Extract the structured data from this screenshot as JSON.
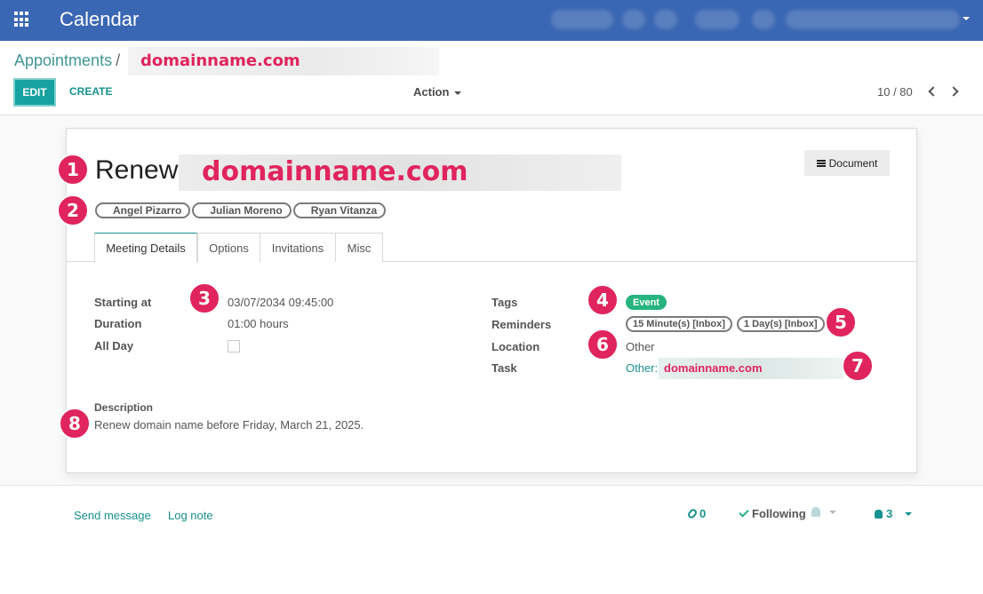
{
  "app": {
    "title": "Calendar",
    "icon": "apps-grid-icon"
  },
  "breadcrumb": {
    "parent": "Appointments",
    "separator": "/",
    "current": "domainname.com"
  },
  "toolbar": {
    "edit_label": "EDIT",
    "create_label": "CREATE",
    "action_label": "Action"
  },
  "pager": {
    "text": "10 / 80"
  },
  "record": {
    "title_prefix": "Renew",
    "title_domain": "domainname.com",
    "document_button": "Document",
    "attendees": [
      "Angel Pizarro",
      "Julian Moreno",
      "Ryan Vitanza"
    ]
  },
  "tabs": [
    {
      "label": "Meeting Details",
      "active": true
    },
    {
      "label": "Options",
      "active": false
    },
    {
      "label": "Invitations",
      "active": false
    },
    {
      "label": "Misc",
      "active": false
    }
  ],
  "details": {
    "starting_at_label": "Starting at",
    "starting_at_value": "03/07/2034 09:45:00",
    "duration_label": "Duration",
    "duration_value": "01:00 hours",
    "all_day_label": "All Day",
    "tags_label": "Tags",
    "tag": "Event",
    "reminders_label": "Reminders",
    "reminders": [
      "15 Minute(s) [Inbox]",
      "1 Day(s) [Inbox]"
    ],
    "location_label": "Location",
    "location_value": "Other",
    "task_label": "Task",
    "task_prefix": "Other:",
    "task_domain": "domainname.com",
    "description_label": "Description",
    "description_value": "Renew domain name before Friday, March 21, 2025."
  },
  "badges": [
    "1",
    "2",
    "3",
    "4",
    "5",
    "6",
    "7",
    "8"
  ],
  "chatter": {
    "send_message": "Send message",
    "log_note": "Log note",
    "attachments_count": "0",
    "following_label": "Following",
    "followers_count": "3"
  },
  "colors": {
    "topbar": "#3a67b3",
    "accent": "#17a2a1",
    "badge": "#e0245e",
    "event_tag": "#27b47e"
  }
}
